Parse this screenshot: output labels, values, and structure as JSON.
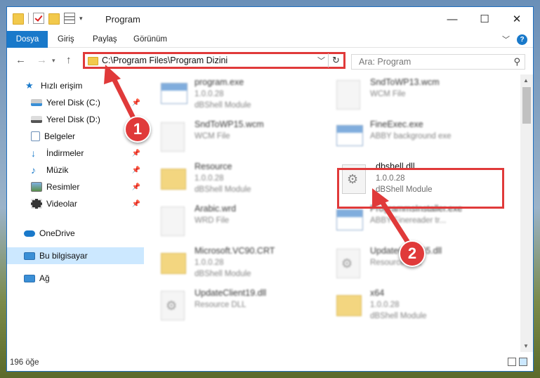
{
  "window": {
    "title": "Program",
    "controls": {
      "minimize": "—",
      "maximize": "☐",
      "close": "✕"
    }
  },
  "ribbon": {
    "tabs": [
      "Dosya",
      "Giriş",
      "Paylaş",
      "Görünüm"
    ],
    "help": "?"
  },
  "nav": {
    "back": "←",
    "forward": "→",
    "up": "↑",
    "address": "C:\\Program Files\\Program Dizini",
    "search_placeholder": "Ara: Program"
  },
  "sidebar": {
    "items": [
      {
        "label": "Hızlı erişim",
        "icon": "star-icon"
      },
      {
        "label": "Yerel Disk (C:)",
        "icon": "drive-icon",
        "pinned": true
      },
      {
        "label": "Yerel Disk (D:)",
        "icon": "drive-icon",
        "pinned": false
      },
      {
        "label": "Belgeler",
        "icon": "documents-icon",
        "pinned": true
      },
      {
        "label": "İndirmeler",
        "icon": "download-icon",
        "pinned": true
      },
      {
        "label": "Müzik",
        "icon": "music-icon",
        "pinned": true
      },
      {
        "label": "Resimler",
        "icon": "pictures-icon",
        "pinned": true
      },
      {
        "label": "Videolar",
        "icon": "video-icon",
        "pinned": true
      },
      {
        "label": "OneDrive",
        "icon": "cloud-icon"
      },
      {
        "label": "Bu bilgisayar",
        "icon": "computer-icon",
        "selected": true
      },
      {
        "label": "Ağ",
        "icon": "network-icon"
      }
    ]
  },
  "files": [
    {
      "name": "program.exe",
      "line1": "1.0.0.28",
      "line2": "dBShell Module",
      "icon": "exe-icon",
      "blurred": true
    },
    {
      "name": "SndToWP13.wcm",
      "line1": "WCM File",
      "line2": "",
      "icon": "file-icon",
      "blurred": true
    },
    {
      "name": "SndToWP15.wcm",
      "line1": "WCM File",
      "line2": "",
      "icon": "file-icon",
      "blurred": true
    },
    {
      "name": "FineExec.exe",
      "line1": "ABBY background exe",
      "line2": "",
      "icon": "app-icon",
      "blurred": true
    },
    {
      "name": "Resource",
      "line1": "1.0.0.28",
      "line2": "dBShell Module",
      "icon": "folder-icon",
      "blurred": true
    },
    {
      "name": "dbshell.dll",
      "line1": "1.0.0.28",
      "line2": "dBShell Module",
      "icon": "dll-icon",
      "blurred": false
    },
    {
      "name": "Arabic.wrd",
      "line1": "WRD File",
      "line2": "",
      "icon": "file-icon",
      "blurred": true
    },
    {
      "name": "ProgrammsInstaller.exe",
      "line1": "ABBY Finereader tr...",
      "line2": "",
      "icon": "app-icon",
      "blurred": true
    },
    {
      "name": "Microsoft.VC90.CRT",
      "line1": "1.0.0.28",
      "line2": "dBShell Module",
      "icon": "folder-icon",
      "blurred": true
    },
    {
      "name": "UpdateClient65.dll",
      "line1": "Resource DLL",
      "line2": "",
      "icon": "dll-icon",
      "blurred": true
    },
    {
      "name": "UpdateClient19.dll",
      "line1": "Resource DLL",
      "line2": "",
      "icon": "dll-icon",
      "blurred": true
    },
    {
      "name": "x64",
      "line1": "1.0.0.28",
      "line2": "dBShell Module",
      "icon": "folder-icon",
      "blurred": true
    }
  ],
  "status": {
    "count": "196 öğe"
  },
  "annotations": [
    {
      "number": "1"
    },
    {
      "number": "2"
    }
  ],
  "colors": {
    "accent": "#1979ca",
    "annotation": "#e03a3a",
    "selected": "#cce8ff"
  }
}
